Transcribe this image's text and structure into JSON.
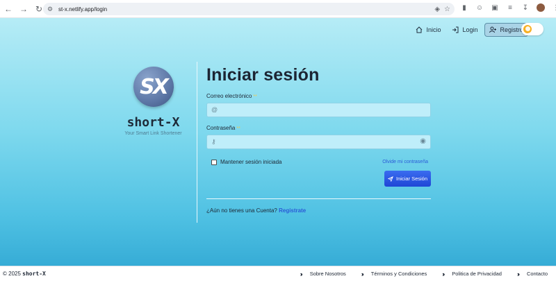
{
  "browser": {
    "url": "st-x.netlify.app/login",
    "nav_icons": [
      "back-icon",
      "forward-icon",
      "reload-icon"
    ],
    "extension_icons": [
      "translate-icon",
      "star-icon",
      "extension-icon",
      "puzzle-icon",
      "media-icon",
      "download-icon",
      "profile-avatar"
    ]
  },
  "topnav": {
    "inicio": "Inicio",
    "login": "Login",
    "registro": "Registro"
  },
  "brand": {
    "logo_text": "SX",
    "name": "short-X",
    "tagline": "Your Smart Link Shortener"
  },
  "form": {
    "title": "Iniciar sesión",
    "email_label": "Correo electrónico",
    "email_required": "**",
    "email_prefix": "@",
    "password_label": "Contraseña",
    "password_required": "**",
    "remember_label": "Mantener sesión iniciada",
    "forgot_label": "Olvide mi contraseña",
    "submit_label": "Iniciar Sesión",
    "signup_prompt": "¿Aún no tienes una Cuenta?",
    "signup_link": "Registrate"
  },
  "footer": {
    "copyright_prefix": "© 2025",
    "copyright_brand": "short-X",
    "links": [
      "Sobre Nosotros",
      "Términos y Condiciones",
      "Politica de Privacidad",
      "Contacto"
    ]
  },
  "colors": {
    "accent": "#2a5bd7",
    "button": "#1f46d6",
    "background_top": "#b6ecf6",
    "background_bottom": "#36acd6"
  }
}
